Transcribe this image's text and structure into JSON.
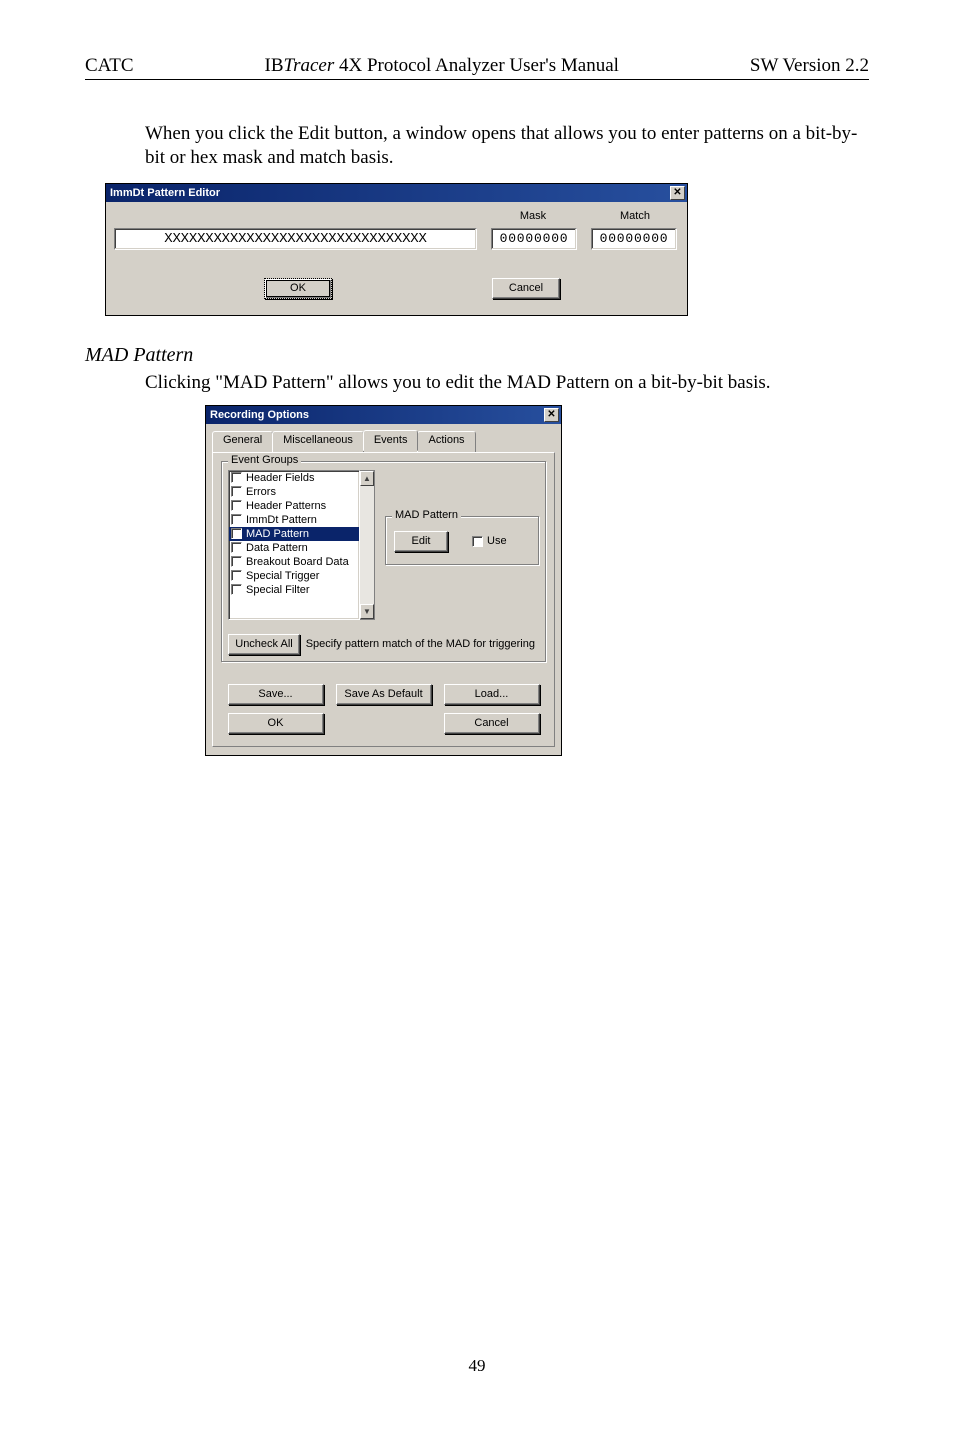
{
  "header": {
    "left": "CATC",
    "center_prefix": "IB",
    "center_italic": "Tracer",
    "center_suffix": " 4X Protocol Analyzer User's Manual",
    "right": "SW Version 2.2"
  },
  "para1": "When you click the Edit button, a window opens that allows you to enter patterns on a bit-by-bit or hex mask and match basis.",
  "immdt": {
    "title": "ImmDt Pattern Editor",
    "mask_label": "Mask",
    "match_label": "Match",
    "bits_value": "XXXXXXXXXXXXXXXXXXXXXXXXXXXXXXXX",
    "mask_value": "00000000",
    "match_value": "00000000",
    "ok": "OK",
    "cancel": "Cancel"
  },
  "section2_title": "MAD Pattern",
  "para2": "Clicking \"MAD Pattern\" allows you to edit the MAD Pattern on a bit-by-bit basis.",
  "rec": {
    "title": "Recording Options",
    "tabs": {
      "general": "General",
      "misc": "Miscellaneous",
      "events": "Events",
      "actions": "Actions"
    },
    "group_title": "Event Groups",
    "items": [
      "Header Fields",
      "Errors",
      "Header Patterns",
      "ImmDt Pattern",
      "MAD Pattern",
      "Data Pattern",
      "Breakout Board Data",
      "Special Trigger",
      "Special Filter"
    ],
    "selected_index": 4,
    "right_group_title": "MAD Pattern",
    "edit_btn": "Edit",
    "use_label": "Use",
    "uncheck_all": "Uncheck All",
    "hint": "Specify pattern match of the MAD for triggering",
    "save": "Save...",
    "save_default": "Save As Default",
    "load": "Load...",
    "ok": "OK",
    "cancel": "Cancel"
  },
  "page_number": "49"
}
